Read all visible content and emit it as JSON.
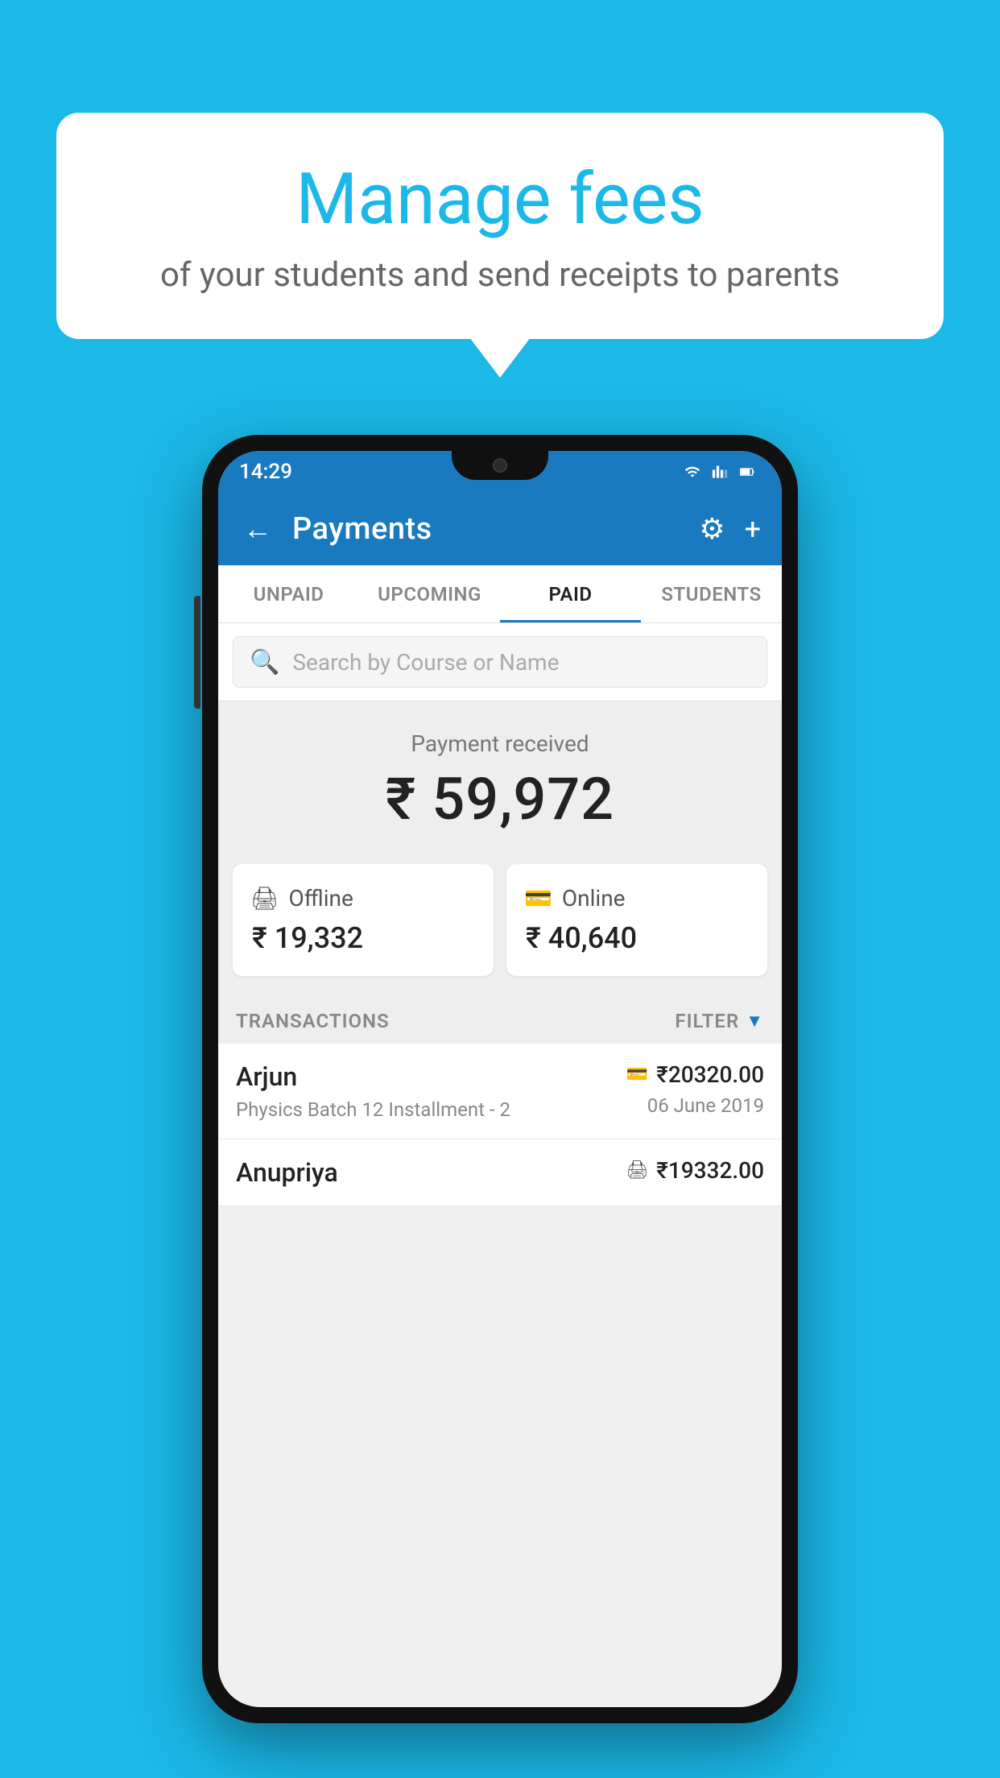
{
  "background_color": "#1bb8e8",
  "speech_bubble": {
    "title": "Manage fees",
    "subtitle": "of your students and send receipts to parents"
  },
  "status_bar": {
    "time": "14:29",
    "wifi_signal": true,
    "battery": true
  },
  "app_bar": {
    "title": "Payments",
    "back_label": "←",
    "gear_label": "⚙",
    "plus_label": "+"
  },
  "tabs": [
    {
      "label": "UNPAID",
      "active": false
    },
    {
      "label": "UPCOMING",
      "active": false
    },
    {
      "label": "PAID",
      "active": true
    },
    {
      "label": "STUDENTS",
      "active": false
    }
  ],
  "search": {
    "placeholder": "Search by Course or Name"
  },
  "payment_received": {
    "label": "Payment received",
    "amount": "₹ 59,972"
  },
  "cards": [
    {
      "type": "Offline",
      "amount": "₹ 19,332",
      "icon": "offline"
    },
    {
      "type": "Online",
      "amount": "₹ 40,640",
      "icon": "online"
    }
  ],
  "transactions": {
    "label": "TRANSACTIONS",
    "filter_label": "FILTER",
    "items": [
      {
        "name": "Arjun",
        "course": "Physics Batch 12 Installment - 2",
        "amount": "₹20320.00",
        "date": "06 June 2019",
        "payment_type": "online"
      },
      {
        "name": "Anupriya",
        "course": "",
        "amount": "₹19332.00",
        "date": "",
        "payment_type": "offline"
      }
    ]
  }
}
